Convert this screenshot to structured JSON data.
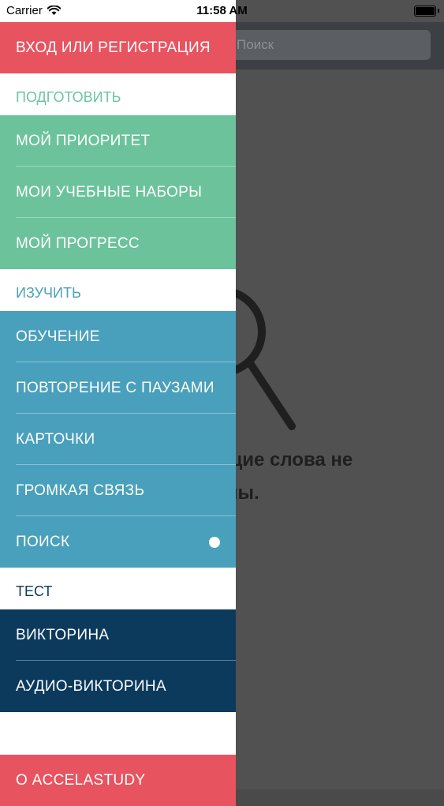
{
  "status_bar": {
    "carrier": "Carrier",
    "time": "11:58 AM"
  },
  "background": {
    "search_placeholder": "Поиск",
    "empty_line1": "щие слова не",
    "empty_line2": "ны."
  },
  "menu": {
    "login": "ВХОД ИЛИ РЕГИСТРАЦИЯ",
    "section_prepare": "ПОДГОТОВИТЬ",
    "prepare_items": [
      "МОЙ ПРИОРИТЕТ",
      "МОИ УЧЕБНЫЕ НАБОРЫ",
      "МОЙ ПРОГРЕСС"
    ],
    "section_learn": "ИЗУЧИТЬ",
    "learn_items": [
      "ОБУЧЕНИЕ",
      "ПОВТОРЕНИЕ С ПАУЗАМИ",
      "КАРТОЧКИ",
      "ГРОМКАЯ СВЯЗЬ",
      "ПОИСК"
    ],
    "section_test": "ТЕСТ",
    "test_items": [
      "ВИКТОРИНА",
      "АУДИО-ВИКТОРИНА"
    ],
    "about": "О ACCELASTUDY",
    "active_item": "ПОИСК",
    "colors": {
      "red": "#e85360",
      "green": "#6cc39b",
      "blue": "#49a0bc",
      "navy": "#0b3a5c"
    }
  }
}
